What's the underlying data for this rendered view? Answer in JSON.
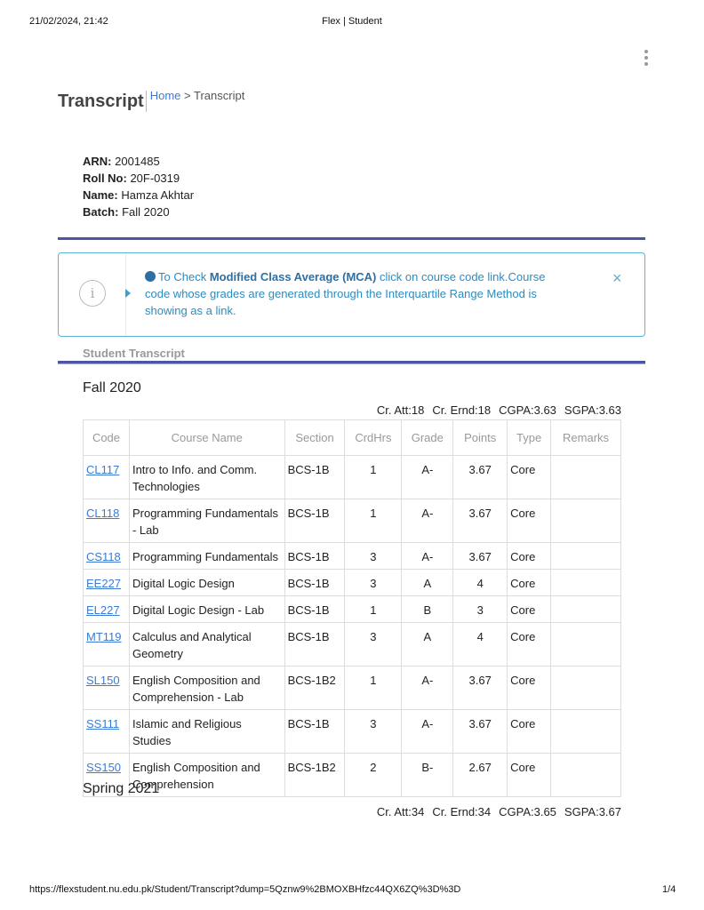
{
  "print_header": {
    "timestamp": "21/02/2024, 21:42",
    "title": "Flex | Student"
  },
  "page": {
    "title": "Transcript"
  },
  "breadcrumb": {
    "home": "Home",
    "separator": ">",
    "current": "Transcript"
  },
  "student": {
    "arn_label": "ARN:",
    "arn": "2001485",
    "roll_label": "Roll No:",
    "roll": "20F-0319",
    "name_label": "Name:",
    "name": "Hamza Akhtar",
    "batch_label": "Batch:",
    "batch": "Fall 2020"
  },
  "alert": {
    "icon": "info-icon",
    "text_before": "To Check ",
    "bold_text": "Modified Class Average (MCA)",
    "text_after": " click on course code link.Course code whose grades are generated through the Interquartile Range Method is showing as a link.",
    "close_symbol": "×"
  },
  "section_label": "Student Transcript",
  "table_headers": [
    "Code",
    "Course Name",
    "Section",
    "CrdHrs",
    "Grade",
    "Points",
    "Type",
    "Remarks"
  ],
  "terms": [
    {
      "name": "Fall 2020",
      "cr_att": "Cr. Att:18",
      "cr_ernd": "Cr. Ernd:18",
      "cgpa": "CGPA:3.63",
      "sgpa": "SGPA:3.63",
      "rows": [
        {
          "code": "CL117",
          "course": "Intro to Info. and Comm. Technologies",
          "section": "BCS-1B",
          "crd": "1",
          "grade": "A-",
          "points": "3.67",
          "type": "Core",
          "remarks": ""
        },
        {
          "code": "CL118",
          "course": "Programming Fundamentals - Lab",
          "section": "BCS-1B",
          "crd": "1",
          "grade": "A-",
          "points": "3.67",
          "type": "Core",
          "remarks": ""
        },
        {
          "code": "CS118",
          "course": "Programming Fundamentals",
          "section": "BCS-1B",
          "crd": "3",
          "grade": "A-",
          "points": "3.67",
          "type": "Core",
          "remarks": ""
        },
        {
          "code": "EE227",
          "course": "Digital Logic Design",
          "section": "BCS-1B",
          "crd": "3",
          "grade": "A",
          "points": "4",
          "type": "Core",
          "remarks": ""
        },
        {
          "code": "EL227",
          "course": "Digital Logic Design - Lab",
          "section": "BCS-1B",
          "crd": "1",
          "grade": "B",
          "points": "3",
          "type": "Core",
          "remarks": ""
        },
        {
          "code": "MT119",
          "course": "Calculus and Analytical Geometry",
          "section": "BCS-1B",
          "crd": "3",
          "grade": "A",
          "points": "4",
          "type": "Core",
          "remarks": ""
        },
        {
          "code": "SL150",
          "course": "English Composition and Comprehension - Lab",
          "section": "BCS-1B2",
          "crd": "1",
          "grade": "A-",
          "points": "3.67",
          "type": "Core",
          "remarks": ""
        },
        {
          "code": "SS111",
          "course": "Islamic and Religious Studies",
          "section": "BCS-1B",
          "crd": "3",
          "grade": "A-",
          "points": "3.67",
          "type": "Core",
          "remarks": ""
        },
        {
          "code": "SS150",
          "course": "English Composition and Comprehension",
          "section": "BCS-1B2",
          "crd": "2",
          "grade": "B-",
          "points": "2.67",
          "type": "Core",
          "remarks": ""
        }
      ]
    },
    {
      "name": "Spring 2021",
      "cr_att": "Cr. Att:34",
      "cr_ernd": "Cr. Ernd:34",
      "cgpa": "CGPA:3.65",
      "sgpa": "SGPA:3.67",
      "rows": []
    }
  ],
  "print_footer": {
    "url": "https://flexstudent.nu.edu.pk/Student/Transcript?dump=5Qznw9%2BMOXBHfzc44QX6ZQ%3D%3D",
    "page": "1/4"
  }
}
